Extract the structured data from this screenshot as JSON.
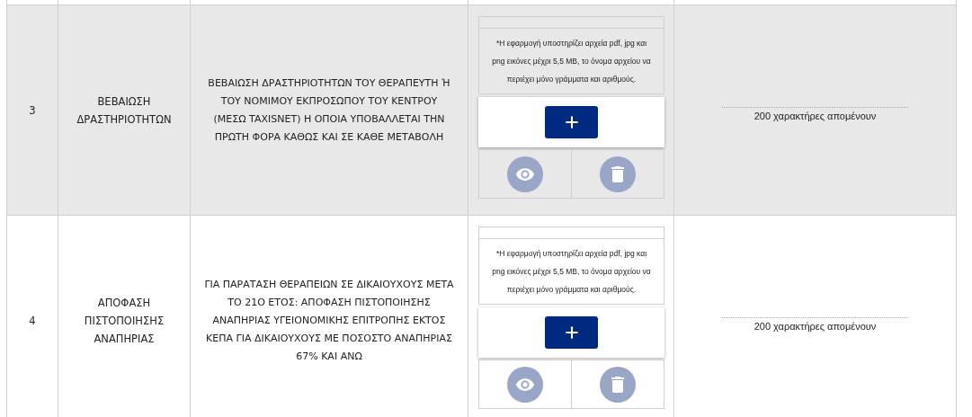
{
  "rows": [
    {
      "number": "3",
      "title": "ΒΕΒΑΙΩΣΗ ΔΡΑΣΤΗΡΙΟΤΗΤΩΝ",
      "description": "ΒΕΒΑΙΩΣΗ ΔΡΑΣΤΗΡΙΟΤΗΤΩΝ ΤΟΥ ΘΕΡΑΠΕΥΤΗ Ή ΤΟΥ ΝΟΜΙΜΟΥ ΕΚΠΡΟΣΩΠΟΥ ΤΟΥ ΚΕΝΤΡΟΥ (ΜΕΣΩ TAXISNET) Η ΟΠΟΙΑ ΥΠΟΒΑΛΛΕΤΑΙ ΤΗΝ ΠΡΩΤΗ ΦΟΡΑ ΚΑΘΩΣ ΚΑΙ ΣΕ ΚΑΘΕ ΜΕΤΑΒΟΛΗ",
      "upload_note": "*Η εφαρμογή υποστηρίζει αρχεία pdf, jpg και png εικόνες μέχρι 5,5 MB, το όνομα αρχείου να περιέχει μόνο γράμματα και αριθμούς.",
      "counter": "200 χαρακτήρες απομένουν",
      "shaded": true
    },
    {
      "number": "4",
      "title": "ΑΠΟΦΑΣΗ ΠΙΣΤΟΠΟΙΗΣΗΣ ΑΝΑΠΗΡΙΑΣ",
      "description": "ΓΙΑ ΠΑΡΑΤΑΣΗ ΘΕΡΑΠΕΙΩΝ ΣΕ ΔΙΚΑΙΟΥΧΟΥΣ ΜΕΤΑ ΤΟ 21Ο ΕΤΟΣ: ΑΠΟΦΑΣΗ ΠΙΣΤΟΠΟΙΗΣΗΣ ΑΝΑΠΗΡΙΑΣ ΥΓΕΙΟΝΟΜΙΚΗΣ ΕΠΙΤΡΟΠΗΣ ΕΚΤΟΣ ΚΕΠΑ ΓΙΑ ΔΙΚΑΙΟΥΧΟΥΣ ΜΕ ΠΟΣΟΣΤΟ ΑΝΑΠΗΡΙΑΣ 67% ΚΑΙ ΑΝΩ",
      "upload_note": "*Η εφαρμογή υποστηρίζει αρχεία pdf, jpg και png εικόνες μέχρι 5,5 MB, το όνομα αρχείου να περιέχει μόνο γράμματα και αριθμούς.",
      "counter": "200 χαρακτήρες απομένουν",
      "shaded": false
    }
  ]
}
